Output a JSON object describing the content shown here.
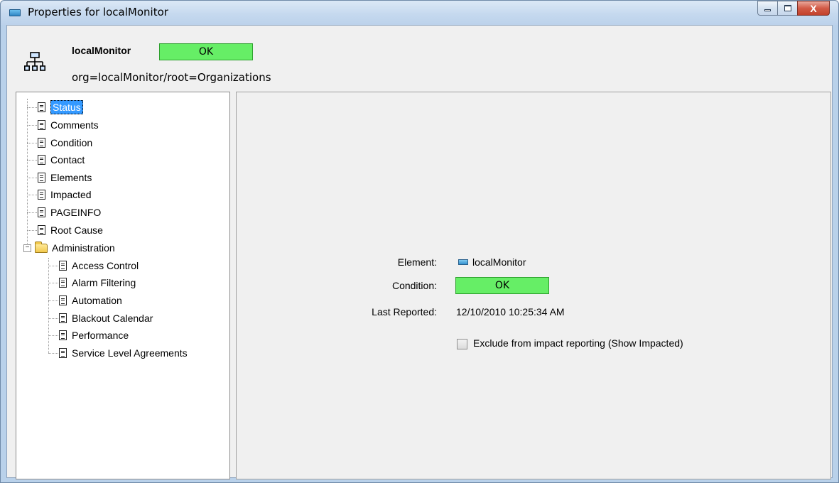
{
  "window": {
    "title": "Properties for localMonitor",
    "icons": {
      "title": "monitor-icon",
      "minimize": "minimize-icon",
      "maximize": "maximize-icon",
      "close": "close-icon"
    },
    "close_glyph": "X"
  },
  "header": {
    "name": "localMonitor",
    "status": "OK",
    "path": "org=localMonitor/root=Organizations",
    "icon": "organization-tree-icon",
    "status_color": "#66ee66"
  },
  "tree": {
    "items": [
      {
        "label": "Status",
        "selected": true
      },
      {
        "label": "Comments"
      },
      {
        "label": "Condition"
      },
      {
        "label": "Contact"
      },
      {
        "label": "Elements"
      },
      {
        "label": "Impacted"
      },
      {
        "label": "PAGEINFO"
      },
      {
        "label": "Root Cause"
      }
    ],
    "folder": {
      "label": "Administration",
      "expanded": true,
      "children": [
        {
          "label": "Access Control"
        },
        {
          "label": "Alarm Filtering"
        },
        {
          "label": "Automation"
        },
        {
          "label": "Blackout Calendar"
        },
        {
          "label": "Performance"
        },
        {
          "label": "Service Level Agreements"
        }
      ]
    }
  },
  "details": {
    "element_label": "Element:",
    "element_value": "localMonitor",
    "condition_label": "Condition:",
    "condition_value": "OK",
    "last_reported_label": "Last Reported:",
    "last_reported_value": "12/10/2010 10:25:34 AM",
    "exclude_label": "Exclude from impact reporting (Show Impacted)",
    "exclude_checked": false
  }
}
